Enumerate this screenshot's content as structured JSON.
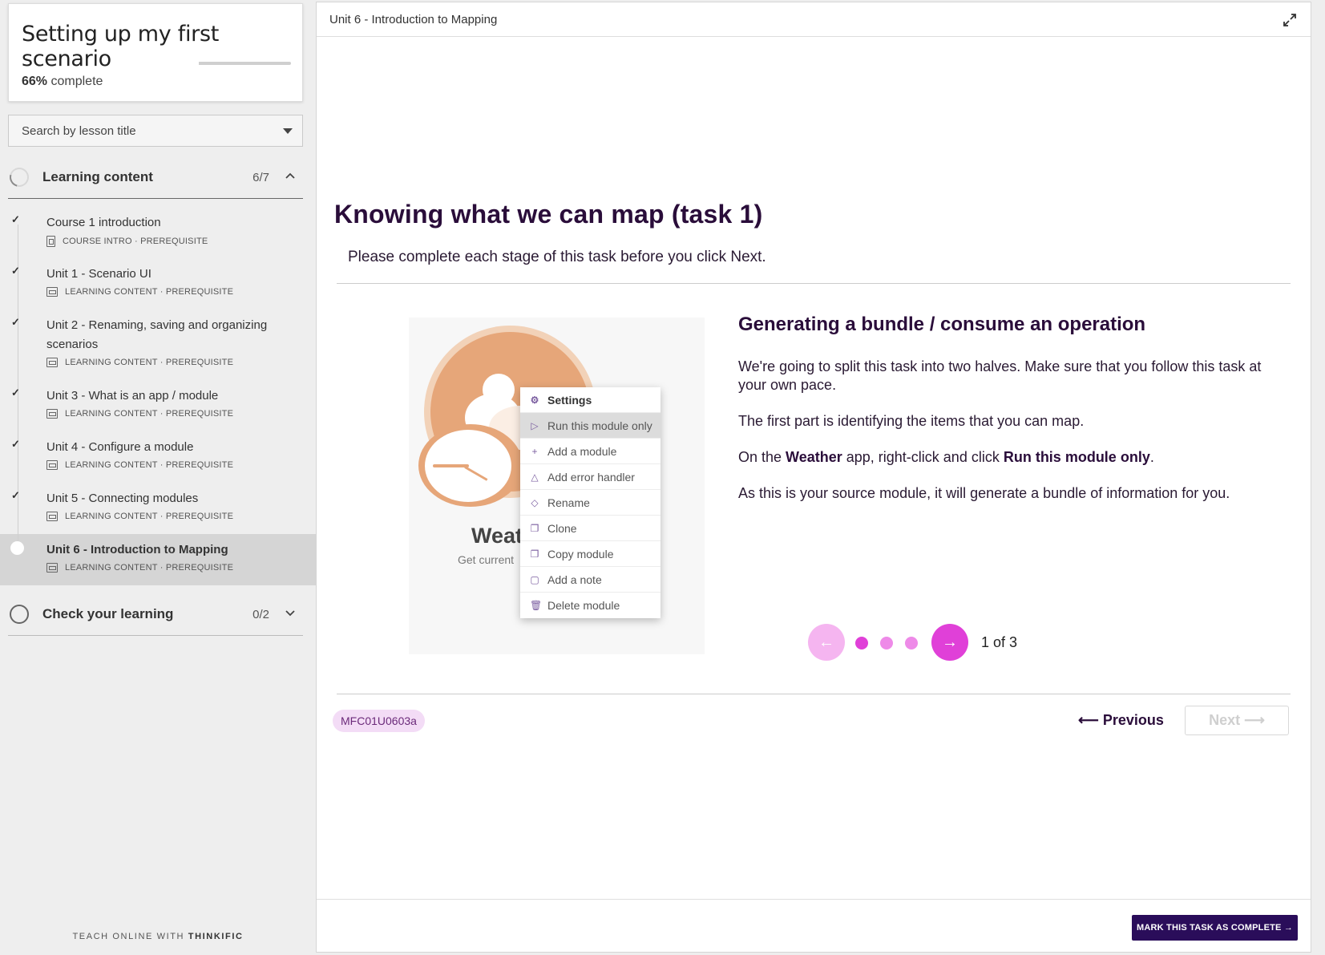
{
  "sidebar": {
    "course_title": "Setting up my first scenario",
    "progress_percent": "66%",
    "progress_suffix": "complete",
    "search_placeholder": "Search by lesson title",
    "chapters": [
      {
        "title": "Learning content",
        "count": "6/7"
      },
      {
        "title": "Check your learning",
        "count": "0/2"
      }
    ],
    "lessons": [
      {
        "title": "Course 1 introduction",
        "meta": "COURSE INTRO · PREREQUISITE",
        "state": "complete"
      },
      {
        "title": "Unit 1 - Scenario UI",
        "meta": "LEARNING CONTENT · PREREQUISITE",
        "state": "complete"
      },
      {
        "title": "Unit 2 - Renaming, saving and organizing scenarios",
        "meta": "LEARNING CONTENT · PREREQUISITE",
        "state": "complete"
      },
      {
        "title": "Unit 3 - What is an app / module",
        "meta": "LEARNING CONTENT · PREREQUISITE",
        "state": "complete"
      },
      {
        "title": "Unit 4 - Configure a module",
        "meta": "LEARNING CONTENT · PREREQUISITE",
        "state": "complete"
      },
      {
        "title": "Unit 5 - Connecting modules",
        "meta": "LEARNING CONTENT · PREREQUISITE",
        "state": "complete"
      },
      {
        "title": "Unit 6 - Introduction to Mapping",
        "meta": "LEARNING CONTENT · PREREQUISITE",
        "state": "current"
      }
    ],
    "footer_prefix": "TEACH ONLINE WITH",
    "footer_brand": "THINKIFIC"
  },
  "main": {
    "topbar_title": "Unit 6 - Introduction to Mapping",
    "heading": "Knowing what we can map (task  1)",
    "subheading": "Please complete each stage of this task before you click Next.",
    "image": {
      "module_name": "Weat",
      "module_desc": "Get current",
      "menu_items": [
        {
          "label": "Settings",
          "icon": "gear-icon"
        },
        {
          "label": "Run this module only",
          "icon": "play-icon"
        },
        {
          "label": "Add a module",
          "icon": "plus-icon"
        },
        {
          "label": "Add error handler",
          "icon": "warning-icon"
        },
        {
          "label": "Rename",
          "icon": "eraser-icon"
        },
        {
          "label": "Clone",
          "icon": "clone-icon"
        },
        {
          "label": "Copy module",
          "icon": "copy-icon"
        },
        {
          "label": "Add a note",
          "icon": "note-icon"
        },
        {
          "label": "Delete module",
          "icon": "trash-icon"
        }
      ]
    },
    "card": {
      "heading": "Generating a bundle / consume an operation",
      "p1": "We're going to split this task into two halves. Make sure that you follow this task at your own pace.",
      "p2": "The first part is identifying the items that you can map.",
      "p3_a": "On the ",
      "p3_b": "Weather",
      "p3_c": " app, right-click and click ",
      "p3_d": "Run this module only",
      "p3_e": ".",
      "p4": "As this is your source module, it will generate a bundle of information for you."
    },
    "carousel": {
      "current": 1,
      "total": 3,
      "label": "1 of 3"
    },
    "tag": "MFC01U0603a",
    "prev_label": "Previous",
    "next_label": "Next",
    "complete_label": "MARK THIS TASK AS COMPLETE"
  },
  "colors": {
    "accent_dark": "#2a0d5a",
    "carousel_active": "#e040d8",
    "carousel_inactive": "#f5b5f0",
    "tag_bg": "#f3dcf6"
  }
}
